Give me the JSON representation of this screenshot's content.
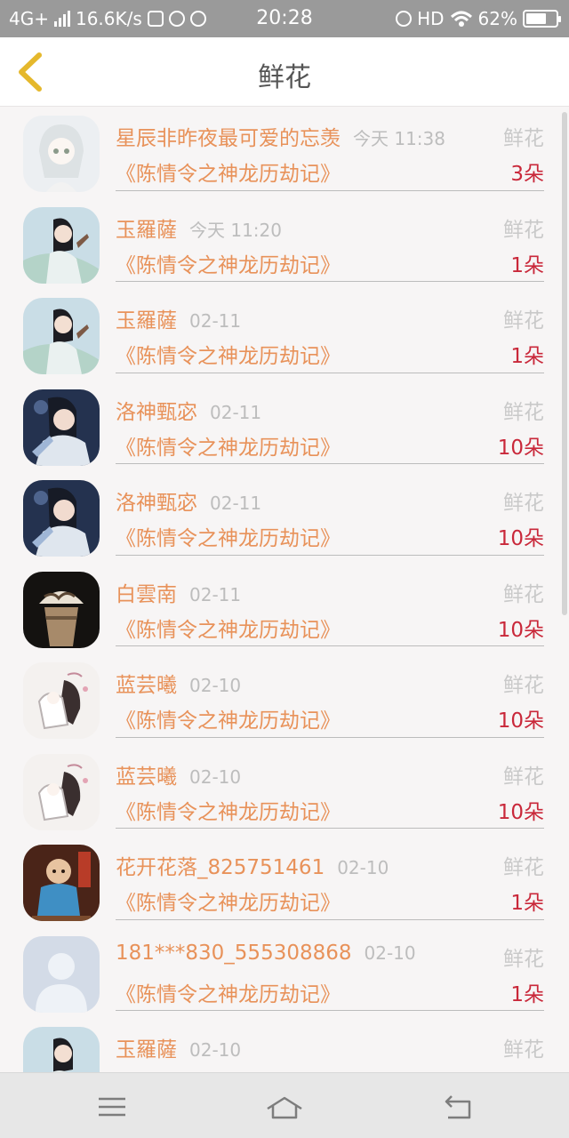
{
  "status_bar": {
    "network": "4G+",
    "speed": "16.6K/s",
    "time": "20:28",
    "hd": "HD",
    "battery": "62%"
  },
  "header": {
    "title": "鲜花"
  },
  "rows": [
    {
      "name": "星辰非昨夜最可爱的忘羡",
      "date": "今天 11:38",
      "type": "鲜花",
      "book": "《陈情令之神龙历劫记》",
      "count": "3朵",
      "avatar": "avatar-white-hair-girl"
    },
    {
      "name": "玉羅薩",
      "date": "今天 11:20",
      "type": "鲜花",
      "book": "《陈情令之神龙历劫记》",
      "count": "1朵",
      "avatar": "avatar-fairy-lady"
    },
    {
      "name": "玉羅薩",
      "date": "02-11",
      "type": "鲜花",
      "book": "《陈情令之神龙历劫记》",
      "count": "1朵",
      "avatar": "avatar-fairy-lady"
    },
    {
      "name": "洛神甄宓",
      "date": "02-11",
      "type": "鲜花",
      "book": "《陈情令之神龙历劫记》",
      "count": "10朵",
      "avatar": "avatar-goddess"
    },
    {
      "name": "洛神甄宓",
      "date": "02-11",
      "type": "鲜花",
      "book": "《陈情令之神龙历劫记》",
      "count": "10朵",
      "avatar": "avatar-goddess"
    },
    {
      "name": "白雲南",
      "date": "02-11",
      "type": "鲜花",
      "book": "《陈情令之神龙历劫记》",
      "count": "10朵",
      "avatar": "avatar-coffee-drink"
    },
    {
      "name": "蓝芸曦",
      "date": "02-10",
      "type": "鲜花",
      "book": "《陈情令之神龙历劫记》",
      "count": "10朵",
      "avatar": "avatar-ink-figures"
    },
    {
      "name": "蓝芸曦",
      "date": "02-10",
      "type": "鲜花",
      "book": "《陈情令之神龙历劫记》",
      "count": "10朵",
      "avatar": "avatar-ink-figures"
    },
    {
      "name": "花开花落_825751461",
      "date": "02-10",
      "type": "鲜花",
      "book": "《陈情令之神龙历劫记》",
      "count": "1朵",
      "avatar": "avatar-little-monk"
    },
    {
      "name": "181***830_555308868",
      "date": "02-10",
      "type": "鲜花",
      "book": "《陈情令之神龙历劫记》",
      "count": "1朵",
      "avatar": "avatar-default-person"
    },
    {
      "name": "玉羅薩",
      "date": "02-10",
      "type": "鲜花",
      "book": "",
      "count": "",
      "avatar": "avatar-fairy-lady"
    }
  ],
  "colors": {
    "accent": "#e8925a",
    "count": "#c9283a",
    "back_icon": "#e5b82c"
  },
  "system_nav": {
    "icons": [
      "menu-icon",
      "home-icon",
      "back-icon"
    ]
  }
}
